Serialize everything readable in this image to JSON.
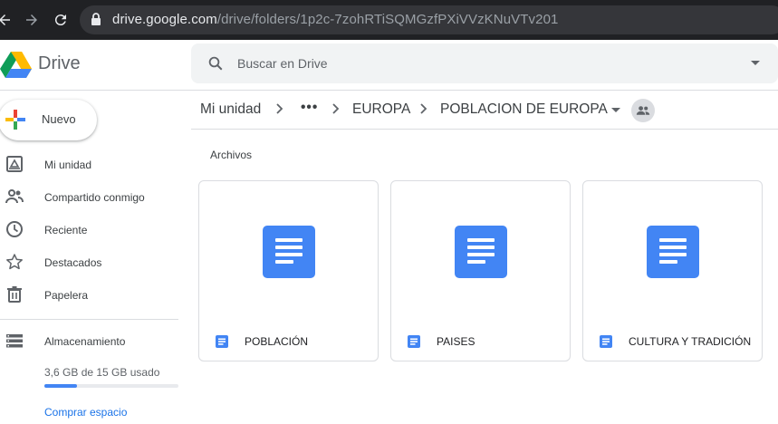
{
  "browser": {
    "url_host": "drive.google.com",
    "url_path": "/drive/folders/1p2c-7zohRTiSQMGzfPXiVVzKNuVTv201"
  },
  "app": {
    "brand": "Drive",
    "search_placeholder": "Buscar en Drive"
  },
  "sidebar": {
    "new_label": "Nuevo",
    "items": [
      {
        "label": "Mi unidad",
        "icon": "my-drive-icon"
      },
      {
        "label": "Compartido conmigo",
        "icon": "shared-icon"
      },
      {
        "label": "Reciente",
        "icon": "clock-icon"
      },
      {
        "label": "Destacados",
        "icon": "star-icon"
      },
      {
        "label": "Papelera",
        "icon": "trash-icon"
      }
    ],
    "storage": {
      "label": "Almacenamiento",
      "usage_text": "3,6 GB de 15 GB usado",
      "used_fraction": 0.24,
      "buy_label": "Comprar espacio"
    }
  },
  "breadcrumb": {
    "root": "Mi unidad",
    "ellipsis": "•••",
    "parent": "EUROPA",
    "current": "POBLACION DE EUROPA"
  },
  "content": {
    "section_title": "Archivos",
    "files": [
      {
        "name": "POBLACIÓN",
        "type": "docs"
      },
      {
        "name": "PAISES",
        "type": "docs"
      },
      {
        "name": "CULTURA Y TRADICIÓN",
        "type": "docs"
      }
    ]
  },
  "colors": {
    "accent": "#1a73e8",
    "docs_blue": "#4285f4",
    "chrome_bg": "#202124"
  }
}
